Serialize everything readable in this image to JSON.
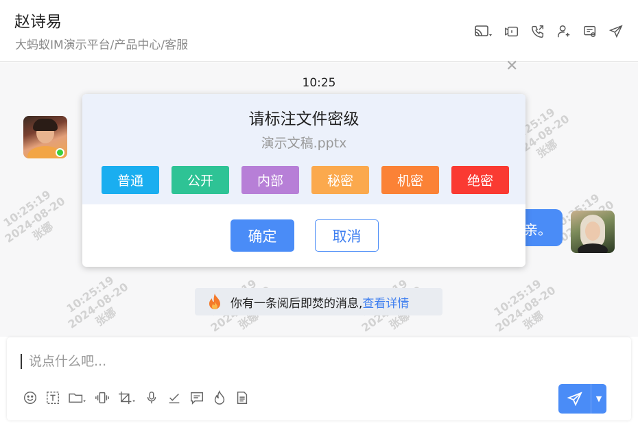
{
  "header": {
    "title": "赵诗易",
    "subtitle": "大蚂蚁IM演示平台/产品中心/客服",
    "icons": [
      "cast-icon",
      "video-call-icon",
      "phone-call-icon",
      "add-user-icon",
      "settings-chat-icon",
      "share-send-icon"
    ]
  },
  "chat": {
    "timestamp": "10:25",
    "right_bubble_text": "亲。",
    "watermark_lines": [
      "10:25:19",
      "2024-08-20",
      "张娜"
    ],
    "notice_text": "你有一条阅后即焚的消息,",
    "notice_link": "查看详情"
  },
  "modal": {
    "title": "请标注文件密级",
    "file_name": "演示文稿.pptx",
    "levels": [
      {
        "label": "普通",
        "color": "#1aaef0"
      },
      {
        "label": "公开",
        "color": "#2ec395"
      },
      {
        "label": "内部",
        "color": "#b77fd7"
      },
      {
        "label": "秘密",
        "color": "#fba94d"
      },
      {
        "label": "机密",
        "color": "#fb8236"
      },
      {
        "label": "绝密",
        "color": "#fa3a32"
      }
    ],
    "ok_label": "确定",
    "cancel_label": "取消"
  },
  "input": {
    "placeholder": "说点什么吧..."
  },
  "colors": {
    "accent": "#4a8cf7",
    "online": "#3bd03b"
  }
}
